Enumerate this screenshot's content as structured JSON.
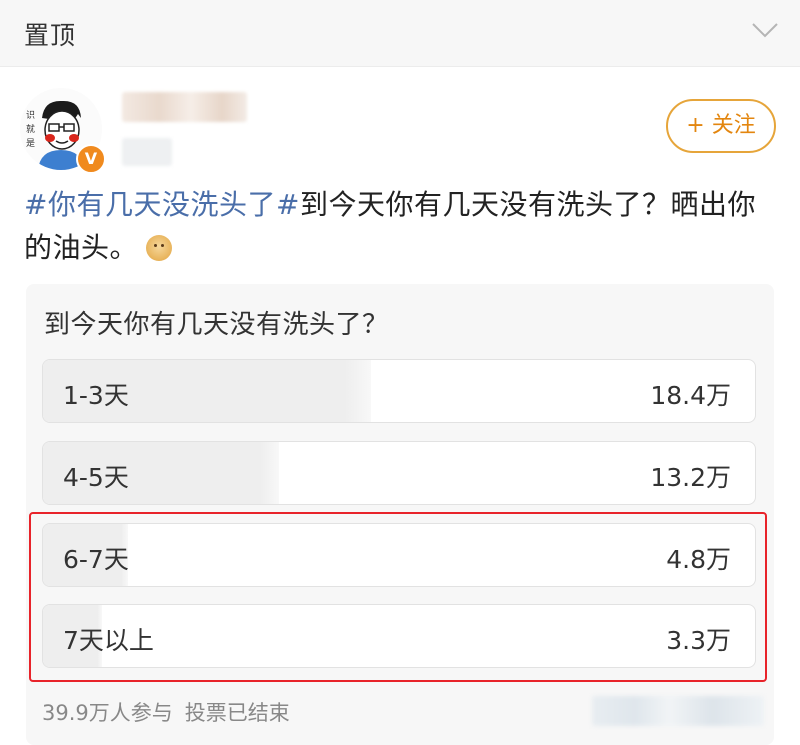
{
  "pinned": {
    "label": "置顶",
    "collapse_icon": "chevron-down-icon"
  },
  "author": {
    "avatar_icon": "cartoon-avatar-icon",
    "verified_mark": "V",
    "follow_label": "+ 关注"
  },
  "post": {
    "hashtag": "#你有几天没洗头了#",
    "text": "到今天你有几天没有洗头了？晒出你的油头。",
    "emoji": "doge-icon"
  },
  "poll": {
    "question": "到今天你有几天没有洗头了？",
    "options": [
      {
        "label": "1-3天",
        "count": "18.4万",
        "share": 0.461
      },
      {
        "label": "4-5天",
        "count": "13.2万",
        "share": 0.331
      },
      {
        "label": "6-7天",
        "count": "4.8万",
        "share": 0.12
      },
      {
        "label": "7天以上",
        "count": "3.3万",
        "share": 0.083
      }
    ],
    "participants": "39.9万人参与",
    "status": "投票已结束"
  },
  "colors": {
    "hashtag": "#4a6ea9",
    "follow": "#e3860f",
    "highlight": "#e8232a",
    "verified": "#f08a1e"
  }
}
